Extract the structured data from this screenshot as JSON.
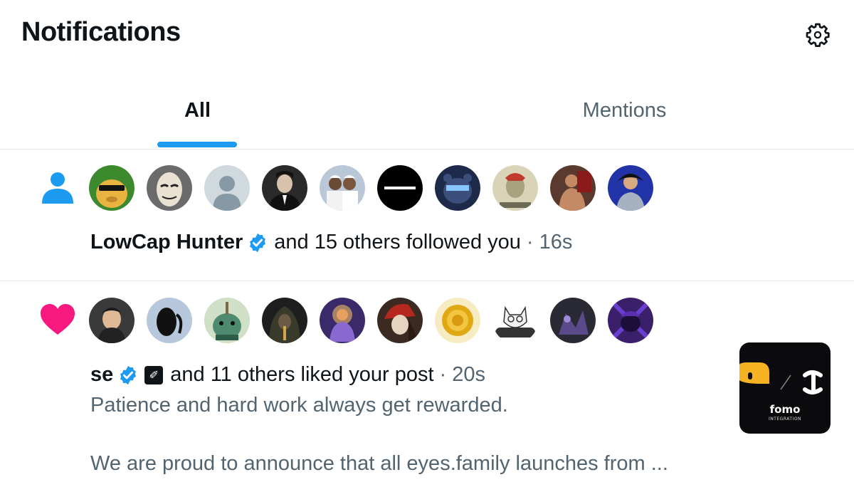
{
  "header": {
    "title": "Notifications",
    "settings_icon": "gear-icon"
  },
  "tabs": [
    {
      "label": "All",
      "active": true
    },
    {
      "label": "Mentions",
      "active": false
    }
  ],
  "colors": {
    "accent": "#1d9bf0",
    "like": "#f91880",
    "text": "#0f1419",
    "muted": "#536471"
  },
  "notifications": [
    {
      "type": "follow",
      "icon": "person-icon",
      "avatar_count": 10,
      "user_name": "LowCap Hunter",
      "verified": true,
      "action": "and 15 others followed you",
      "time": "16s"
    },
    {
      "type": "like",
      "icon": "heart-icon",
      "avatar_count": 10,
      "user_name": "se",
      "verified": true,
      "badge": "✐",
      "action": "and 11 others liked your post",
      "time": "20s",
      "preview_line_1": "Patience and hard work always get rewarded.",
      "preview_line_2": "We are proud to announce that all eyes.family launches from ...",
      "thumbnail": {
        "label": "fomo",
        "sublabel": "INTEGRATION"
      }
    }
  ]
}
